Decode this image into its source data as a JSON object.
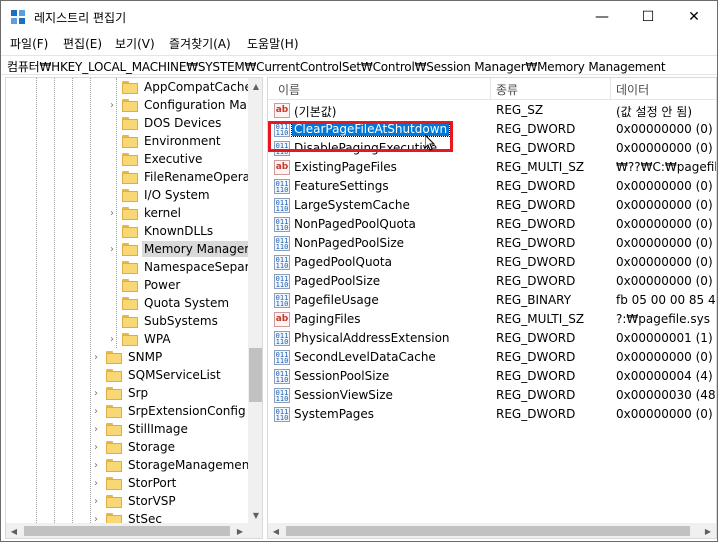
{
  "window": {
    "title": "레지스트리 편집기",
    "controls": {
      "minimize": "—",
      "maximize": "☐",
      "close": "✕"
    }
  },
  "menu": [
    "파일(F)",
    "편집(E)",
    "보기(V)",
    "즐겨찾기(A)",
    "도움말(H)"
  ],
  "address": "컴퓨터₩HKEY_LOCAL_MACHINE₩SYSTEM₩CurrentControlSet₩Control₩Session Manager₩Memory Management",
  "tree": {
    "items": [
      {
        "label": "AppCompatCache",
        "indent": 2,
        "expandable": false,
        "selected": false
      },
      {
        "label": "Configuration Mana",
        "indent": 2,
        "expandable": true,
        "selected": false
      },
      {
        "label": "DOS Devices",
        "indent": 2,
        "expandable": false,
        "selected": false
      },
      {
        "label": "Environment",
        "indent": 2,
        "expandable": false,
        "selected": false
      },
      {
        "label": "Executive",
        "indent": 2,
        "expandable": false,
        "selected": false
      },
      {
        "label": "FileRenameOperatio",
        "indent": 2,
        "expandable": false,
        "selected": false
      },
      {
        "label": "I/O System",
        "indent": 2,
        "expandable": false,
        "selected": false
      },
      {
        "label": "kernel",
        "indent": 2,
        "expandable": true,
        "selected": false
      },
      {
        "label": "KnownDLLs",
        "indent": 2,
        "expandable": false,
        "selected": false
      },
      {
        "label": "Memory Managem",
        "indent": 2,
        "expandable": true,
        "selected": true
      },
      {
        "label": "NamespaceSeparat",
        "indent": 2,
        "expandable": false,
        "selected": false
      },
      {
        "label": "Power",
        "indent": 2,
        "expandable": false,
        "selected": false
      },
      {
        "label": "Quota System",
        "indent": 2,
        "expandable": false,
        "selected": false
      },
      {
        "label": "SubSystems",
        "indent": 2,
        "expandable": false,
        "selected": false
      },
      {
        "label": "WPA",
        "indent": 2,
        "expandable": true,
        "selected": false
      },
      {
        "label": "SNMP",
        "indent": 1,
        "expandable": true,
        "selected": false
      },
      {
        "label": "SQMServiceList",
        "indent": 1,
        "expandable": false,
        "selected": false
      },
      {
        "label": "Srp",
        "indent": 1,
        "expandable": true,
        "selected": false
      },
      {
        "label": "SrpExtensionConfig",
        "indent": 1,
        "expandable": true,
        "selected": false
      },
      {
        "label": "StillImage",
        "indent": 1,
        "expandable": true,
        "selected": false
      },
      {
        "label": "Storage",
        "indent": 1,
        "expandable": true,
        "selected": false
      },
      {
        "label": "StorageManagement",
        "indent": 1,
        "expandable": true,
        "selected": false
      },
      {
        "label": "StorPort",
        "indent": 1,
        "expandable": true,
        "selected": false
      },
      {
        "label": "StorVSP",
        "indent": 1,
        "expandable": true,
        "selected": false
      },
      {
        "label": "StSec",
        "indent": 1,
        "expandable": true,
        "selected": false
      }
    ]
  },
  "list": {
    "columns": [
      "이름",
      "종류",
      "데이터"
    ],
    "rows": [
      {
        "name": "(기본값)",
        "type": "REG_SZ",
        "data": "(값 설정 안 됨)",
        "icon": "string-value-icon",
        "selected": false
      },
      {
        "name": "ClearPageFileAtShutdown",
        "type": "REG_DWORD",
        "data": "0x00000000 (0)",
        "icon": "binary-value-icon",
        "selected": true
      },
      {
        "name": "DisablePagingExecutive",
        "type": "REG_DWORD",
        "data": "0x00000000 (0)",
        "icon": "binary-value-icon",
        "selected": false
      },
      {
        "name": "ExistingPageFiles",
        "type": "REG_MULTI_SZ",
        "data": "₩??₩C:₩pagefile.s",
        "icon": "string-value-icon",
        "selected": false
      },
      {
        "name": "FeatureSettings",
        "type": "REG_DWORD",
        "data": "0x00000000 (0)",
        "icon": "binary-value-icon",
        "selected": false
      },
      {
        "name": "LargeSystemCache",
        "type": "REG_DWORD",
        "data": "0x00000000 (0)",
        "icon": "binary-value-icon",
        "selected": false
      },
      {
        "name": "NonPagedPoolQuota",
        "type": "REG_DWORD",
        "data": "0x00000000 (0)",
        "icon": "binary-value-icon",
        "selected": false
      },
      {
        "name": "NonPagedPoolSize",
        "type": "REG_DWORD",
        "data": "0x00000000 (0)",
        "icon": "binary-value-icon",
        "selected": false
      },
      {
        "name": "PagedPoolQuota",
        "type": "REG_DWORD",
        "data": "0x00000000 (0)",
        "icon": "binary-value-icon",
        "selected": false
      },
      {
        "name": "PagedPoolSize",
        "type": "REG_DWORD",
        "data": "0x00000000 (0)",
        "icon": "binary-value-icon",
        "selected": false
      },
      {
        "name": "PagefileUsage",
        "type": "REG_BINARY",
        "data": "fb 05 00 00 85 47",
        "icon": "binary-value-icon",
        "selected": false
      },
      {
        "name": "PagingFiles",
        "type": "REG_MULTI_SZ",
        "data": "?:₩pagefile.sys",
        "icon": "string-value-icon",
        "selected": false
      },
      {
        "name": "PhysicalAddressExtension",
        "type": "REG_DWORD",
        "data": "0x00000001 (1)",
        "icon": "binary-value-icon",
        "selected": false
      },
      {
        "name": "SecondLevelDataCache",
        "type": "REG_DWORD",
        "data": "0x00000000 (0)",
        "icon": "binary-value-icon",
        "selected": false
      },
      {
        "name": "SessionPoolSize",
        "type": "REG_DWORD",
        "data": "0x00000004 (4)",
        "icon": "binary-value-icon",
        "selected": false
      },
      {
        "name": "SessionViewSize",
        "type": "REG_DWORD",
        "data": "0x00000030 (48)",
        "icon": "binary-value-icon",
        "selected": false
      },
      {
        "name": "SystemPages",
        "type": "REG_DWORD",
        "data": "0x00000000 (0)",
        "icon": "binary-value-icon",
        "selected": false
      }
    ]
  },
  "colors": {
    "selection": "#0078d7",
    "highlight_box": "#e8171f",
    "folder": "#f8d775"
  }
}
